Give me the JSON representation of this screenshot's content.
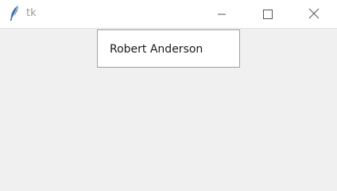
{
  "window": {
    "title": "tk",
    "icon": "feather-icon",
    "controls": {
      "minimize_icon": "minimize-icon",
      "maximize_icon": "maximize-icon",
      "close_icon": "close-icon"
    }
  },
  "main": {
    "entry_value": "Robert Anderson"
  },
  "colors": {
    "titlebar_bg": "#ffffff",
    "window_bg": "#f0f0f0",
    "box_border": "#a0a0a0",
    "title_text": "#9a9a9a"
  }
}
